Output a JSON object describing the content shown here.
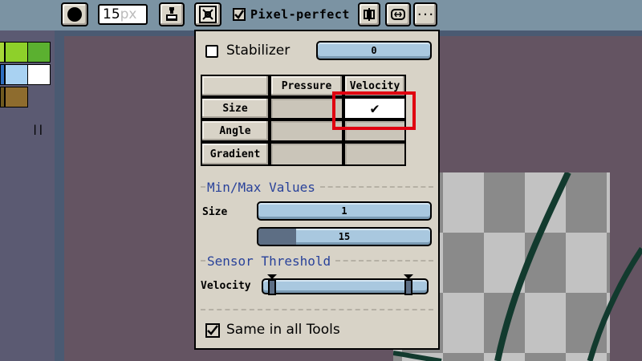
{
  "toolbar": {
    "brush_size": "15",
    "brush_unit": "px",
    "pixel_perfect_label": "Pixel-perfect",
    "more_label": "···"
  },
  "popup": {
    "stabilizer_label": "Stabilizer",
    "stabilizer_value": "0",
    "table": {
      "columns": [
        "",
        "Pressure",
        "Velocity"
      ],
      "rows": [
        {
          "label": "Size",
          "pressure": "",
          "velocity": "✔"
        },
        {
          "label": "Angle",
          "pressure": "",
          "velocity": ""
        },
        {
          "label": "Gradient",
          "pressure": "",
          "velocity": ""
        }
      ]
    },
    "minmax_title": "Min/Max Values",
    "size_label": "Size",
    "min_value": "1",
    "max_value": "15",
    "max_fill_fraction": 0.22,
    "threshold_title": "Sensor Threshold",
    "velocity_label": "Velocity",
    "same_in_all_tools_label": "Same in all Tools"
  },
  "colors": {
    "toolbar_bg": "#7b93a3",
    "popup_bg": "#d8d3c7",
    "section_title": "#29429a",
    "bar_blue": "#a9c8df",
    "highlight_red": "#e00010",
    "editor_bg": "#645462",
    "stroke": "#123a2e"
  },
  "icons": [
    "brush-dot-icon",
    "ink-icon",
    "brush-tool-icon",
    "check-icon",
    "symmetry-icon",
    "wrap-icon"
  ]
}
